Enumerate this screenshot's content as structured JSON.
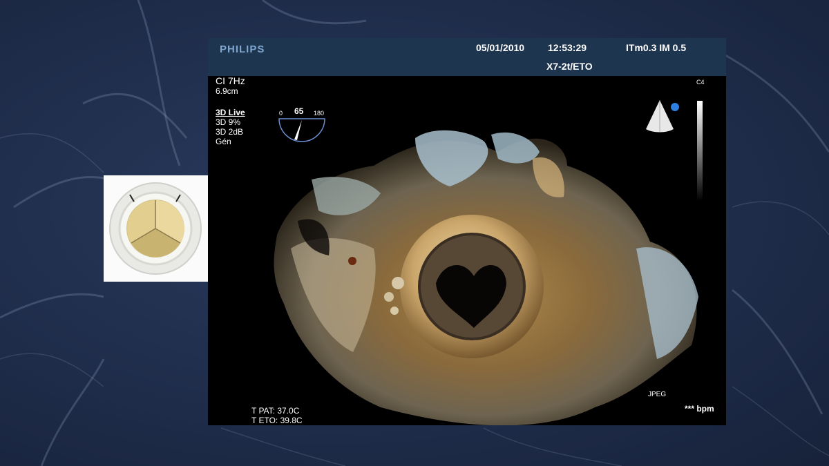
{
  "thumbnail": {
    "alt": "mechanical heart valve prosthesis"
  },
  "ultrasound": {
    "header": {
      "brand": "PHILIPS",
      "date": "05/01/2010",
      "time": "12:53:29",
      "indices": "ITm0.3  IM 0.5",
      "probe": "X7-2t/ETO"
    },
    "left_info": {
      "line1": "CI 7Hz",
      "line2": "6.9cm",
      "mode_title": "3D Live",
      "mode_line1": "3D  9%",
      "mode_line2": "3D  2dB",
      "mode_line3": "Gén"
    },
    "angle_gauge": {
      "min": "0",
      "value": "65",
      "max": "180"
    },
    "preset": "C4",
    "format": "JPEG",
    "heart_rate": "*** bpm",
    "temperatures": {
      "patient": "T PAT: 37.0C",
      "probe": "T ETO: 39.8C"
    }
  },
  "colors": {
    "header_bg": "#1e3550",
    "brand": "#7ea6cf",
    "background": "#1f2d4b"
  }
}
